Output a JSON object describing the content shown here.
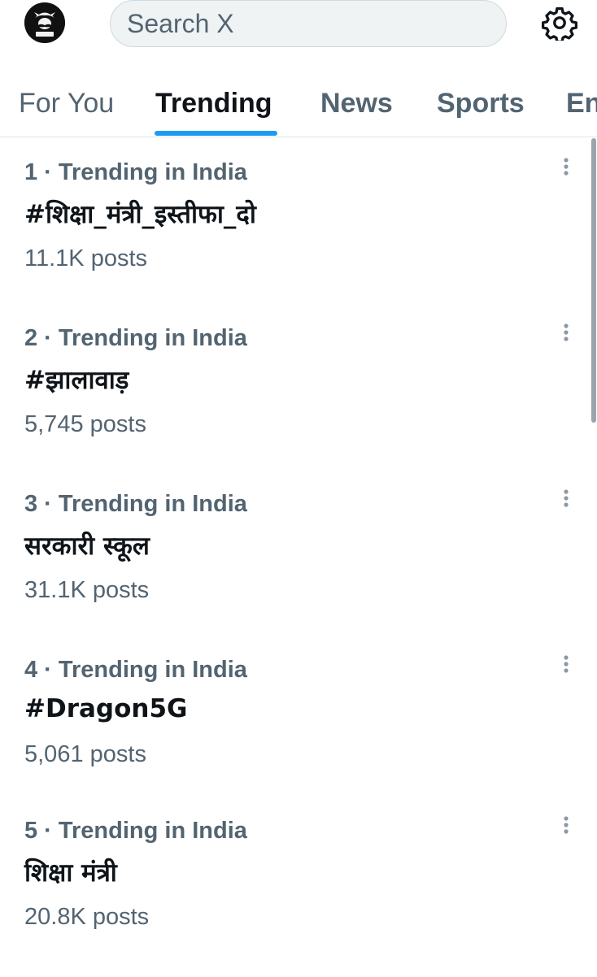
{
  "header": {
    "avatar_icon": "profile-avatar-icon",
    "search": {
      "placeholder": "Search X",
      "value": ""
    },
    "settings_icon": "gear-icon"
  },
  "tabs": [
    {
      "label": "For You",
      "active": false
    },
    {
      "label": "Trending",
      "active": true
    },
    {
      "label": "News",
      "active": false
    },
    {
      "label": "Sports",
      "active": false
    },
    {
      "label": "En",
      "active": false
    }
  ],
  "trends": [
    {
      "context": "1 · Trending in India",
      "title": "#शिक्षा_मंत्री_इस्तीफा_दो",
      "posts": "11.1K posts"
    },
    {
      "context": "2 · Trending in India",
      "title": "#झालावाड़",
      "posts": "5,745 posts"
    },
    {
      "context": "3 · Trending in India",
      "title": "सरकारी स्कूल",
      "posts": "31.1K posts"
    },
    {
      "context": "4 · Trending in India",
      "title": "#Dragon5G",
      "posts": "5,061 posts"
    },
    {
      "context": "5 · Trending in India",
      "title": "शिक्षा मंत्री",
      "posts": "20.8K posts"
    }
  ],
  "colors": {
    "accent": "#1d9bf0",
    "text_primary": "#0f1419",
    "text_secondary": "#536471",
    "search_bg": "#eff3f4"
  }
}
